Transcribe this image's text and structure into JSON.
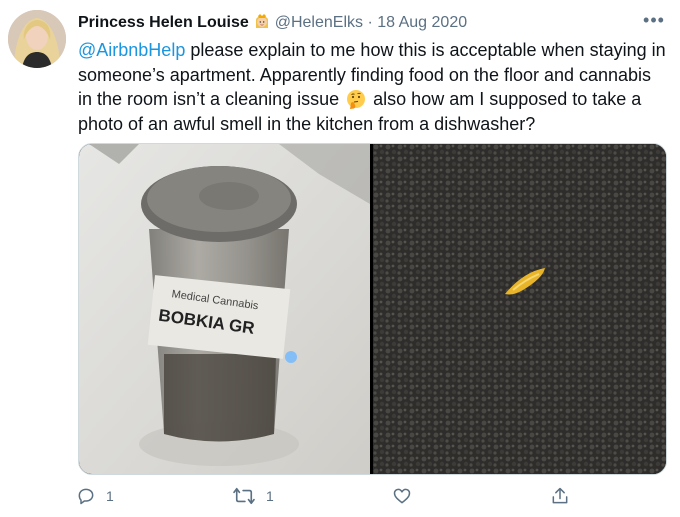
{
  "tweet": {
    "display_name": "Princess Helen Louise",
    "handle": "@HelenElks",
    "separator": "·",
    "date": "18 Aug 2020",
    "more_label": "•••",
    "text_mention": "@AirbnbHelp",
    "text_part1": " please explain to me how this is acceptable when staying in someone’s apartment. Apparently finding food on the floor and cannabis in the room isn’t a cleaning issue ",
    "text_part2": " also how am I supposed to take a photo of an awful smell in the kitchen from a dishwasher?",
    "jar_label_line1": "Medical Cannabis",
    "jar_label_line2": "BOBKIA GR"
  },
  "actions": {
    "reply_count": "1",
    "retweet_count": "1"
  },
  "icons": {
    "name_emoji": "princess-emoji-icon",
    "inline_emoji": "thinking-face-icon",
    "reply": "reply-icon",
    "retweet": "retweet-icon",
    "like": "heart-icon",
    "share": "share-icon"
  },
  "colors": {
    "link": "#1b95e0",
    "secondary_text": "#5b7083",
    "primary_text": "#0f1419",
    "border": "#cfd9de"
  }
}
